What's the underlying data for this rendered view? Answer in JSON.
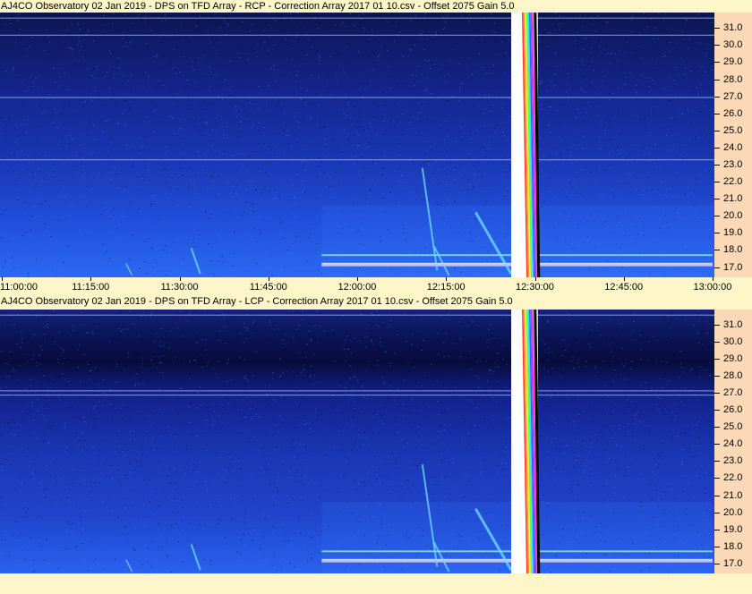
{
  "chart_data": [
    {
      "type": "heatmap",
      "title": "AJ4CO Observatory 02 Jan 2019  -  DPS on TFD Array  -  RCP  -  Correction Array 2017 01 10.csv  -  Offset 2075  Gain 5.0",
      "polarization": "RCP",
      "yticks": [
        "31.0",
        "30.0",
        "29.0",
        "28.0",
        "27.0",
        "26.0",
        "25.0",
        "24.0",
        "23.0",
        "22.0",
        "21.0",
        "20.0",
        "19.0",
        "18.0",
        "17.0"
      ],
      "ylim": [
        16.4,
        31.9
      ],
      "xticks": [
        "11:00:00",
        "11:15:00",
        "11:30:00",
        "11:45:00",
        "12:00:00",
        "12:15:00",
        "12:30:00",
        "12:45:00",
        "13:00:00"
      ],
      "xlim": [
        "11:00:00",
        "13:00:00"
      ],
      "data_gap": [
        "12:26:00",
        "12:30:30"
      ]
    },
    {
      "type": "heatmap",
      "title": "AJ4CO Observatory 02 Jan 2019  -  DPS on TFD Array  -  LCP  -  Correction Array 2017 01 10.csv  -  Offset 2075  Gain 5.0",
      "polarization": "LCP",
      "yticks": [
        "31.0",
        "30.0",
        "29.0",
        "28.0",
        "27.0",
        "26.0",
        "25.0",
        "24.0",
        "23.0",
        "22.0",
        "21.0",
        "20.0",
        "19.0",
        "18.0",
        "17.0"
      ],
      "ylim": [
        16.4,
        31.9
      ],
      "xlim": [
        "11:00:00",
        "13:00:00"
      ],
      "data_gap": [
        "12:26:00",
        "12:30:30"
      ]
    }
  ],
  "colors": {
    "background": "#fdf6c8",
    "yaxis_bg": "#fbd9b7",
    "spectrum_dark": "#0a1460",
    "spectrum_mid": "#1d3fc6",
    "spectrum_bright": "#2f7dff",
    "burst": "#6fe0ff"
  }
}
